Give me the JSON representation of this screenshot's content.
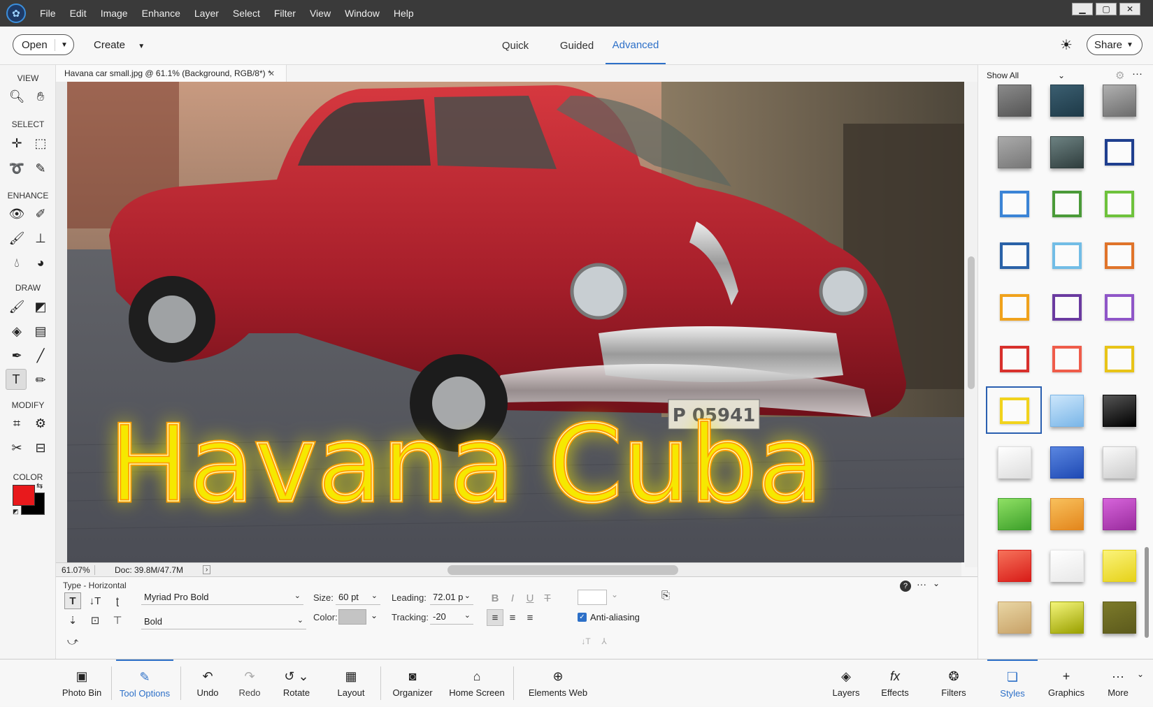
{
  "menubar": {
    "items": [
      "File",
      "Edit",
      "Image",
      "Enhance",
      "Layer",
      "Select",
      "Filter",
      "View",
      "Window",
      "Help"
    ]
  },
  "topbar": {
    "open_label": "Open",
    "create_label": "Create",
    "modes": [
      "Quick",
      "Guided",
      "Advanced"
    ],
    "active_mode": "Advanced",
    "share_label": "Share"
  },
  "toolbox": {
    "sections": [
      "VIEW",
      "SELECT",
      "ENHANCE",
      "DRAW",
      "MODIFY",
      "COLOR"
    ]
  },
  "document": {
    "tab_title": "Havana car small.jpg @ 61.1% (Background, RGB/8*) *",
    "overlay_text": "Havana Cuba",
    "plate_text": "P 05941",
    "zoom": "61.07%",
    "doc_size": "Doc: 39.8M/47.7M"
  },
  "tool_options": {
    "title": "Type - Horizontal",
    "font_family": "Myriad Pro Bold",
    "font_style": "Bold",
    "size_label": "Size:",
    "size_value": "60 pt",
    "leading_label": "Leading:",
    "leading_value": "72.01 p",
    "color_label": "Color:",
    "tracking_label": "Tracking:",
    "tracking_value": "-20",
    "anti_aliasing_label": "Anti-aliasing",
    "anti_aliasing": true
  },
  "styles_panel": {
    "filter_label": "Show All"
  },
  "taskbar": {
    "items": [
      "Photo Bin",
      "Tool Options",
      "Undo",
      "Redo",
      "Rotate",
      "Layout",
      "Organizer",
      "Home Screen",
      "Elements Web",
      "Layers",
      "Effects",
      "Filters",
      "Styles",
      "Graphics",
      "More"
    ],
    "active": [
      "Tool Options",
      "Styles"
    ]
  },
  "colors": {
    "accent": "#2d70c8",
    "foreground_color": "#e8191c",
    "background_color": "#000000",
    "text_glow": "#f4ec00"
  }
}
